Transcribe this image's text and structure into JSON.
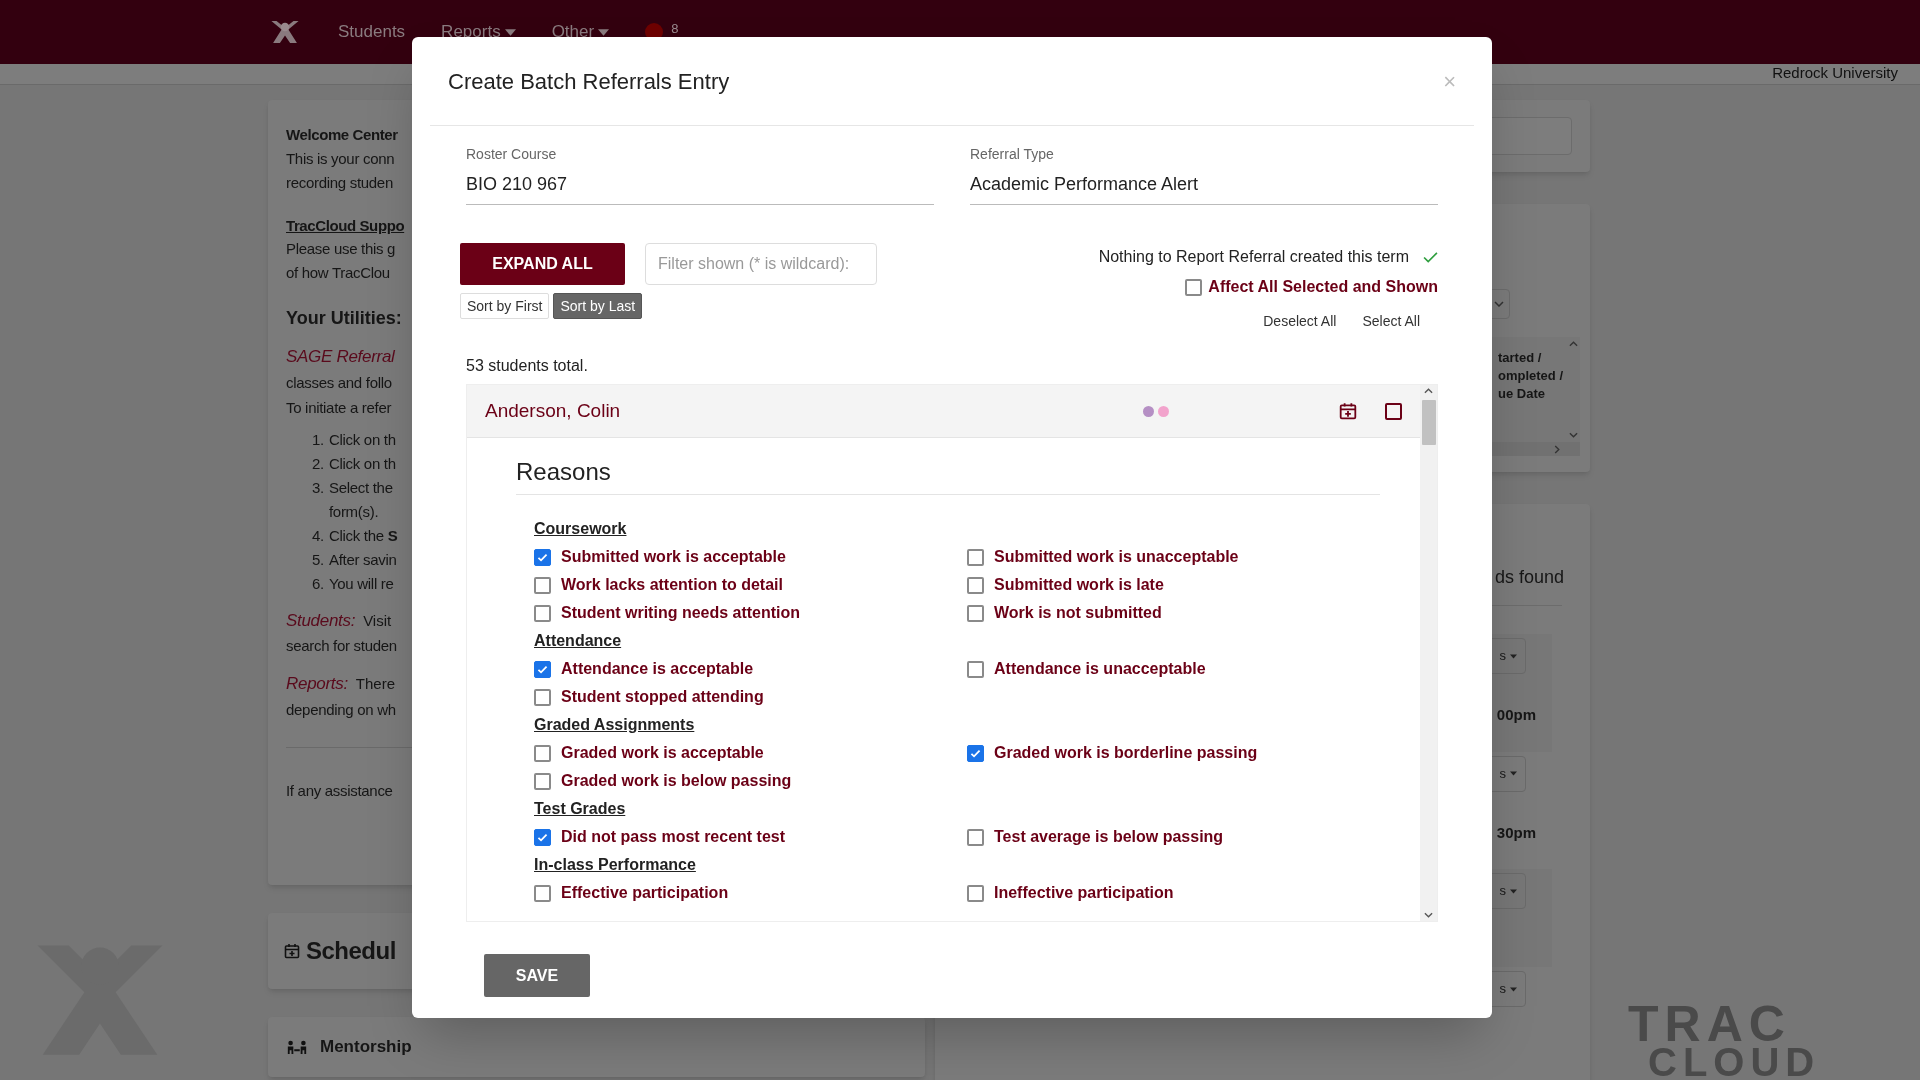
{
  "nav": {
    "items": [
      {
        "label": "Students",
        "caret": false
      },
      {
        "label": "Reports",
        "caret": true
      },
      {
        "label": "Other",
        "caret": true
      }
    ],
    "badge": "8"
  },
  "org": "Redrock University",
  "welcome_card": {
    "blocks": [
      {
        "kind": "title",
        "text": "Welcome Center"
      },
      {
        "kind": "para",
        "lines": [
          "This is your conn",
          "recording studen"
        ]
      },
      {
        "kind": "subtitle",
        "text": "TracCloud Suppo"
      },
      {
        "kind": "para",
        "lines": [
          "Please use this g",
          "of how TracClou"
        ]
      },
      {
        "kind": "heading",
        "text": "Your Utilities:"
      },
      {
        "kind": "lead",
        "label": "SAGE Referral",
        "lines": [
          "classes and follo"
        ]
      },
      {
        "kind": "para",
        "lines": [
          "To initiate a refer"
        ]
      },
      {
        "kind": "list",
        "items": [
          {
            "marker": "1.",
            "lines": [
              "Click on th"
            ]
          },
          {
            "marker": "2.",
            "lines": [
              "Click on th"
            ]
          },
          {
            "marker": "3.",
            "lines": [
              "Select the",
              "form(s)."
            ]
          },
          {
            "marker": "4.",
            "lines": [
              "Click the **S**"
            ]
          },
          {
            "marker": "5.",
            "lines": [
              "After savin"
            ]
          },
          {
            "marker": "6.",
            "lines": [
              "You will re"
            ]
          }
        ]
      },
      {
        "kind": "lead",
        "label": "Students:",
        "rest": "Visit",
        "lines": [
          "search for studen"
        ]
      },
      {
        "kind": "lead",
        "label": "Reports:",
        "rest": "There",
        "lines": [
          "depending on wh"
        ]
      },
      {
        "kind": "footer",
        "lines": [
          "If any assistance"
        ]
      }
    ]
  },
  "schedule_card": {
    "title": "Schedul"
  },
  "mentorship_card": {
    "title": "Mentorship"
  },
  "right_panel": {
    "table_header": [
      "tarted /",
      "ompleted /",
      "ue Date"
    ],
    "results": "ds found",
    "rows": [
      {
        "button": "s",
        "time": "00pm"
      },
      {
        "button": "s",
        "time": "30pm"
      },
      {
        "button": "s"
      },
      {
        "button": "s"
      }
    ]
  },
  "footer_logo": {
    "line1": "TRAC",
    "line2": "CLOUD"
  },
  "modal": {
    "title": "Create Batch Referrals Entry",
    "close": "×",
    "fields": [
      {
        "label": "Roster Course",
        "value": "BIO 210 967"
      },
      {
        "label": "Referral Type",
        "value": "Academic Performance Alert"
      }
    ],
    "expand_button": "EXPAND ALL",
    "filter": {
      "placeholder": "Filter shown (* is wildcard):"
    },
    "sort_buttons": [
      {
        "label": "Sort by First",
        "selected": false
      },
      {
        "label": "Sort by Last",
        "selected": true
      }
    ],
    "nothing_to_report": {
      "text": "Nothing to Report Referral created this term",
      "done": true
    },
    "affect_all": {
      "label": "Affect All Selected and Shown",
      "checked": false
    },
    "links": [
      "Deselect All",
      "Select All"
    ],
    "total": "53 students total.",
    "student": {
      "name": "Anderson, Colin",
      "dots": [
        {
          "color": "#b58fc4"
        },
        {
          "color": "#f2a3cc"
        }
      ],
      "selected": false,
      "reasons_title": "Reasons",
      "categories": [
        {
          "title": "Coursework",
          "rows": [
            [
              {
                "label": "Submitted work is acceptable",
                "checked": true
              },
              {
                "label": "Submitted work is unacceptable",
                "checked": false
              }
            ],
            [
              {
                "label": "Work lacks attention to detail",
                "checked": false
              },
              {
                "label": "Submitted work is late",
                "checked": false
              }
            ],
            [
              {
                "label": "Student writing needs attention",
                "checked": false
              },
              {
                "label": "Work is not submitted",
                "checked": false
              }
            ]
          ]
        },
        {
          "title": "Attendance",
          "rows": [
            [
              {
                "label": "Attendance is acceptable",
                "checked": true
              },
              {
                "label": "Attendance is unacceptable",
                "checked": false
              }
            ],
            [
              {
                "label": "Student stopped attending",
                "checked": false
              }
            ]
          ]
        },
        {
          "title": "Graded Assignments",
          "rows": [
            [
              {
                "label": "Graded work is acceptable",
                "checked": false
              },
              {
                "label": "Graded work is borderline passing",
                "checked": true
              }
            ],
            [
              {
                "label": "Graded work is below passing",
                "checked": false
              }
            ]
          ]
        },
        {
          "title": "Test Grades",
          "rows": [
            [
              {
                "label": "Did not pass most recent test",
                "checked": true
              },
              {
                "label": "Test average is below passing",
                "checked": false
              }
            ]
          ]
        },
        {
          "title": "In-class Performance",
          "rows": [
            [
              {
                "label": "Effective participation",
                "checked": false
              },
              {
                "label": "Ineffective participation",
                "checked": false
              }
            ]
          ]
        }
      ]
    },
    "save_button": "SAVE"
  }
}
